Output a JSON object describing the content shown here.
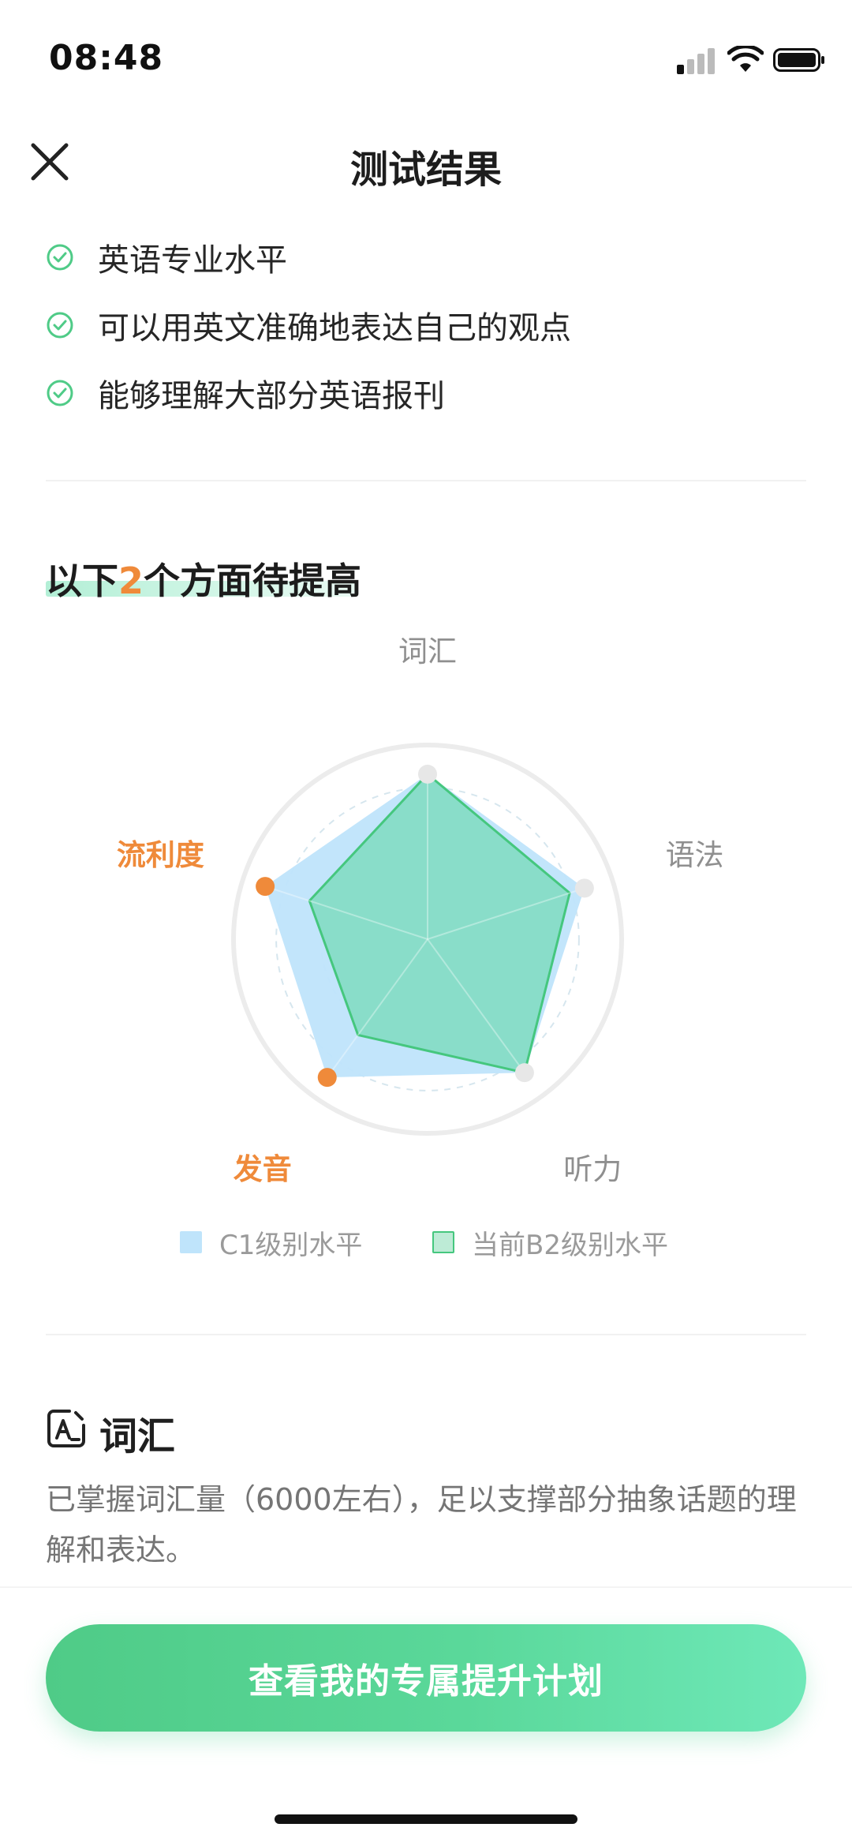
{
  "status_bar": {
    "time": "08:48",
    "icons": [
      "cellular-signal-icon",
      "wifi-icon",
      "battery-icon"
    ]
  },
  "nav": {
    "title": "测试结果",
    "close_icon": "close-icon"
  },
  "achievements": [
    "英语专业水平",
    "可以用英文准确地表达自己的观点",
    "能够理解大部分英语报刊"
  ],
  "improve": {
    "prefix": "以下",
    "count": "2",
    "suffix": "个方面待提高"
  },
  "chart_data": {
    "type": "radar",
    "axes": [
      "词汇",
      "语法",
      "听力",
      "发音",
      "流利度"
    ],
    "highlighted_axes": [
      "流利度",
      "发音"
    ],
    "range": [
      0,
      1
    ],
    "series": [
      {
        "name": "C1级别水平",
        "values": [
          0.85,
          0.85,
          0.85,
          0.88,
          0.88
        ]
      },
      {
        "name": "当前B2级别水平",
        "values": [
          0.85,
          0.77,
          0.85,
          0.61,
          0.64
        ]
      }
    ],
    "grid": "concentric-circles"
  },
  "colors": {
    "accent_green": "#4fcb87",
    "highlight_orange": "#ef8a3a",
    "c1_fill": "#bfe4fb",
    "b2_fill": "#7fdcc0",
    "b2_stroke": "#45c77e",
    "axis_label_gray": "#8f8f8f"
  },
  "vocab": {
    "icon": "vocabulary-card-icon",
    "title": "词汇",
    "desc": "已掌握词汇量（6000左右），足以支撑部分抽象话题的理解和表达。"
  },
  "cta": {
    "label": "查看我的专属提升计划"
  }
}
